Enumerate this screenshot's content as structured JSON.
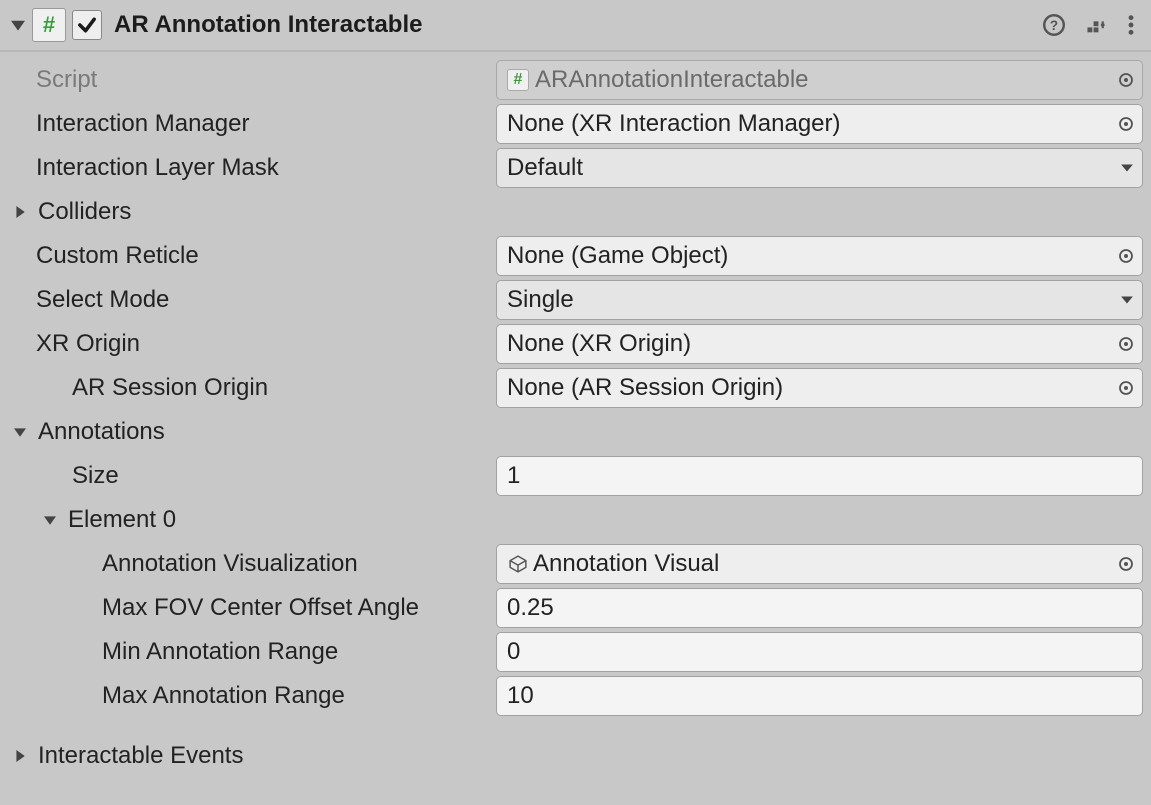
{
  "header": {
    "title": "AR Annotation Interactable",
    "enabled": true
  },
  "fields": {
    "script_label": "Script",
    "script_value": "ARAnnotationInteractable",
    "interaction_manager_label": "Interaction Manager",
    "interaction_manager_value": "None (XR Interaction Manager)",
    "interaction_layer_mask_label": "Interaction Layer Mask",
    "interaction_layer_mask_value": "Default",
    "colliders_label": "Colliders",
    "custom_reticle_label": "Custom Reticle",
    "custom_reticle_value": "None (Game Object)",
    "select_mode_label": "Select Mode",
    "select_mode_value": "Single",
    "xr_origin_label": "XR Origin",
    "xr_origin_value": "None (XR Origin)",
    "ar_session_origin_label": "AR Session Origin",
    "ar_session_origin_value": "None (AR Session Origin)",
    "annotations_label": "Annotations",
    "annotations_size_label": "Size",
    "annotations_size_value": "1",
    "element0_label": "Element 0",
    "annotation_visualization_label": "Annotation Visualization",
    "annotation_visualization_value": "Annotation Visual",
    "max_fov_label": "Max FOV Center Offset Angle",
    "max_fov_value": "0.25",
    "min_range_label": "Min Annotation Range",
    "min_range_value": "0",
    "max_range_label": "Max Annotation Range",
    "max_range_value": "10",
    "interactable_events_label": "Interactable Events"
  }
}
